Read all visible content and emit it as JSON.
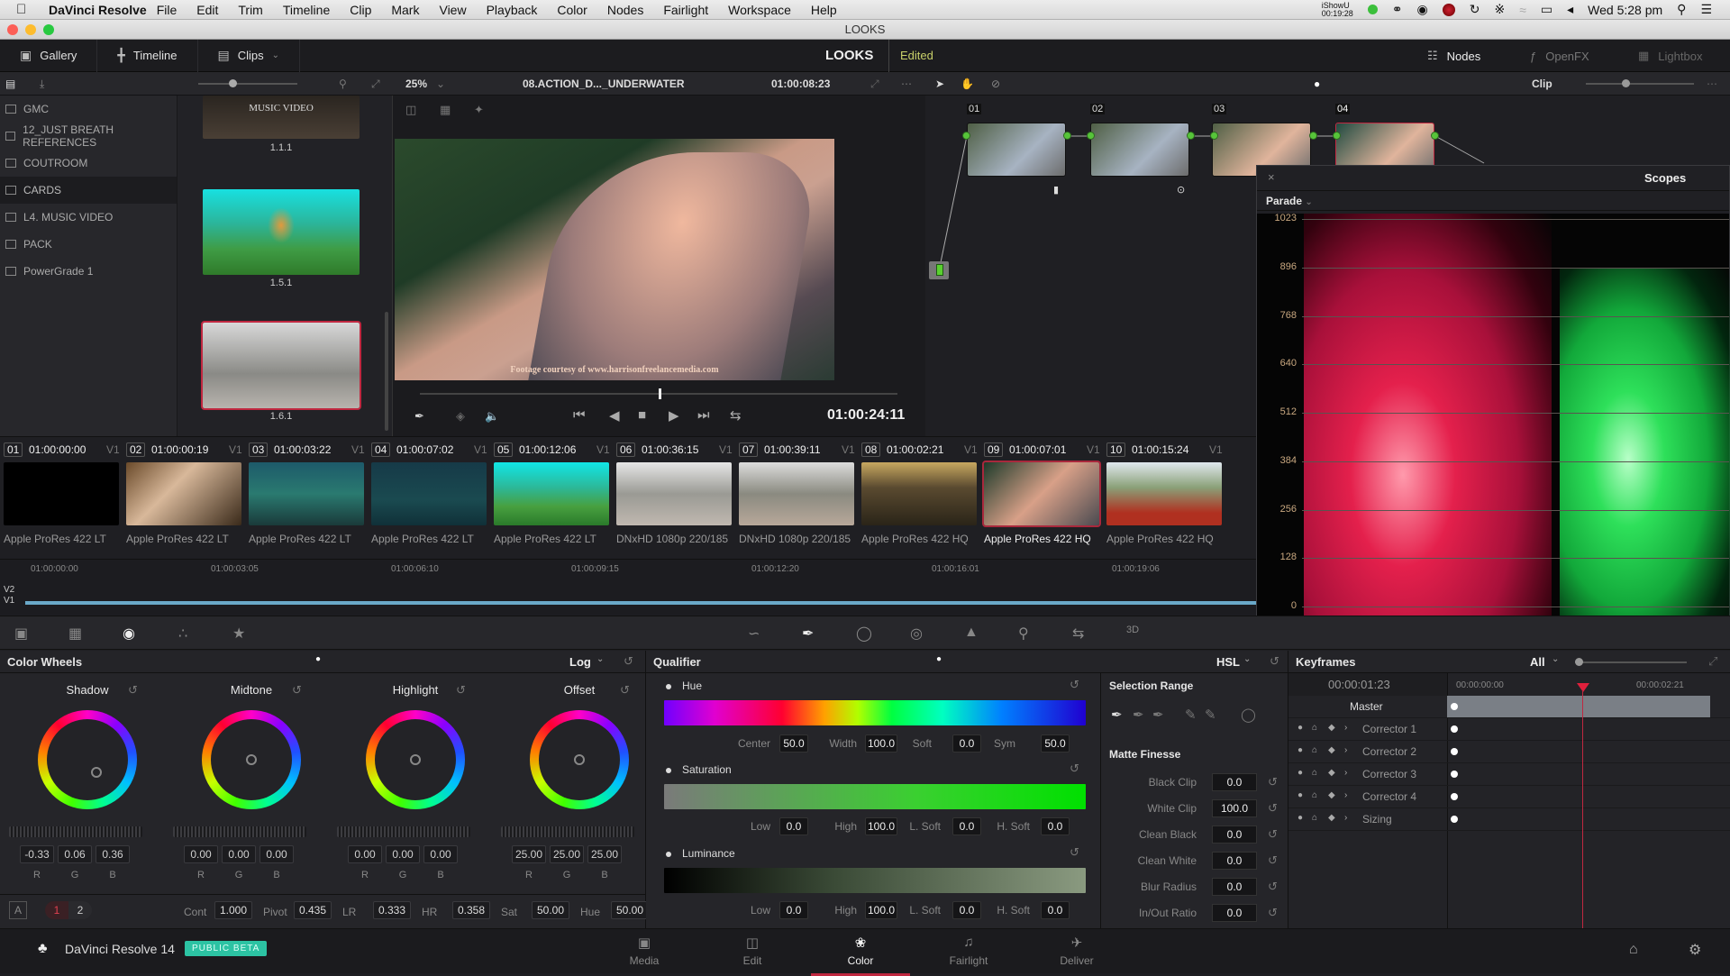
{
  "menubar": {
    "app_name": "DaVinci Resolve",
    "items": [
      "File",
      "Edit",
      "Trim",
      "Timeline",
      "Clip",
      "Mark",
      "View",
      "Playback",
      "Color",
      "Nodes",
      "Fairlight",
      "Workspace",
      "Help"
    ],
    "ishowu_label": "iShowU",
    "ishowu_time": "00:19:28",
    "clock": "Wed 5:28 pm"
  },
  "window": {
    "title": "LOOKS"
  },
  "toolbar": {
    "gallery": "Gallery",
    "timeline": "Timeline",
    "clips": "Clips",
    "project": "LOOKS",
    "status": "Edited",
    "nodes": "Nodes",
    "openfx": "OpenFX",
    "lightbox": "Lightbox"
  },
  "viewer_bar": {
    "zoom": "25%",
    "clip_name": "08.ACTION_D..._UNDERWATER",
    "timecode": "01:00:08:23",
    "node_mode": "Clip"
  },
  "gallery": {
    "albums": [
      {
        "label": "GMC",
        "selected": false
      },
      {
        "label": "12_JUST BREATH REFERENCES",
        "selected": false
      },
      {
        "label": "COUTROOM",
        "selected": false
      },
      {
        "label": "CARDS",
        "selected": true
      },
      {
        "label": "L4. MUSIC VIDEO",
        "selected": false
      },
      {
        "label": "PACK",
        "selected": false
      },
      {
        "label": "PowerGrade 1",
        "selected": false
      }
    ],
    "stills": [
      {
        "label": "1.1.1",
        "caption": "MUSIC VIDEO"
      },
      {
        "label": "1.5.1"
      },
      {
        "label": "1.6.1",
        "selected": true
      }
    ]
  },
  "viewer": {
    "caption": "Footage courtesy of www.harrisonfreelancemedia.com",
    "timecode": "01:00:24:11",
    "scrub_position": 0.5
  },
  "node_graph": {
    "nodes": [
      {
        "label": "01"
      },
      {
        "label": "02"
      },
      {
        "label": "03"
      },
      {
        "label": "04",
        "selected": true
      }
    ]
  },
  "scopes": {
    "title": "Scopes",
    "mode": "Parade",
    "scale": [
      "1023",
      "896",
      "768",
      "640",
      "512",
      "384",
      "256",
      "128",
      "0"
    ]
  },
  "clips": [
    {
      "num": "01",
      "tc": "01:00:00:00",
      "track": "V1",
      "codec": "Apple ProRes 422 LT",
      "thumb": "title"
    },
    {
      "num": "02",
      "tc": "01:00:00:19",
      "track": "V1",
      "codec": "Apple ProRes 422 LT",
      "thumb": "nudibranch"
    },
    {
      "num": "03",
      "tc": "01:00:03:22",
      "track": "V1",
      "codec": "Apple ProRes 422 LT",
      "thumb": "reef"
    },
    {
      "num": "04",
      "tc": "01:00:07:02",
      "track": "V1",
      "codec": "Apple ProRes 422 LT",
      "thumb": "diver"
    },
    {
      "num": "05",
      "tc": "01:00:12:06",
      "track": "V1",
      "codec": "Apple ProRes 422 LT",
      "thumb": "seadragon"
    },
    {
      "num": "06",
      "tc": "01:00:36:15",
      "track": "V1",
      "codec": "DNxHD 1080p 220/185",
      "thumb": "bush1"
    },
    {
      "num": "07",
      "tc": "01:00:39:11",
      "track": "V1",
      "codec": "DNxHD 1080p 220/185",
      "thumb": "bush2"
    },
    {
      "num": "08",
      "tc": "01:00:02:21",
      "track": "V1",
      "codec": "Apple ProRes 422 HQ",
      "thumb": "sunset"
    },
    {
      "num": "09",
      "tc": "01:00:07:01",
      "track": "V1",
      "codec": "Apple ProRes 422 HQ",
      "thumb": "river",
      "selected": true
    },
    {
      "num": "10",
      "tc": "01:00:15:24",
      "track": "V1",
      "codec": "Apple ProRes 422 HQ",
      "thumb": "outback"
    }
  ],
  "timeline_ruler": [
    "01:00:00:00",
    "01:00:03:05",
    "01:00:06:10",
    "01:00:09:15",
    "01:00:12:20",
    "01:00:16:01",
    "01:00:19:06"
  ],
  "tracks": [
    "V2",
    "V1"
  ],
  "color_wheels": {
    "title": "Color Wheels",
    "mode": "Log",
    "wheels": [
      {
        "name": "Shadow",
        "r": "-0.33",
        "g": "0.06",
        "b": "0.36"
      },
      {
        "name": "Midtone",
        "r": "0.00",
        "g": "0.00",
        "b": "0.00"
      },
      {
        "name": "Highlight",
        "r": "0.00",
        "g": "0.00",
        "b": "0.00"
      },
      {
        "name": "Offset",
        "r": "25.00",
        "g": "25.00",
        "b": "25.00"
      }
    ],
    "channel_labels": [
      "R",
      "G",
      "B"
    ],
    "mode_a": "A",
    "page1": "1",
    "page2": "2",
    "params": [
      {
        "label": "Cont",
        "value": "1.000"
      },
      {
        "label": "Pivot",
        "value": "0.435"
      },
      {
        "label": "LR",
        "value": "0.333"
      },
      {
        "label": "HR",
        "value": "0.358"
      },
      {
        "label": "Sat",
        "value": "50.00"
      },
      {
        "label": "Hue",
        "value": "50.00"
      }
    ]
  },
  "qualifier": {
    "title": "Qualifier",
    "mode": "HSL",
    "hue": {
      "label": "Hue",
      "center_label": "Center",
      "center": "50.0",
      "width_label": "Width",
      "width": "100.0",
      "soft_label": "Soft",
      "soft": "0.0",
      "sym_label": "Sym",
      "sym": "50.0"
    },
    "saturation": {
      "label": "Saturation",
      "low_label": "Low",
      "low": "0.0",
      "high_label": "High",
      "high": "100.0",
      "lsoft_label": "L. Soft",
      "lsoft": "0.0",
      "hsoft_label": "H. Soft",
      "hsoft": "0.0"
    },
    "luminance": {
      "label": "Luminance",
      "low_label": "Low",
      "low": "0.0",
      "high_label": "High",
      "high": "100.0",
      "lsoft_label": "L. Soft",
      "lsoft": "0.0",
      "hsoft_label": "H. Soft",
      "hsoft": "0.0"
    },
    "selection_range": "Selection Range",
    "matte_finesse": "Matte Finesse",
    "matte": [
      {
        "label": "Black Clip",
        "value": "0.0"
      },
      {
        "label": "White Clip",
        "value": "100.0"
      },
      {
        "label": "Clean Black",
        "value": "0.0"
      },
      {
        "label": "Clean White",
        "value": "0.0"
      },
      {
        "label": "Blur Radius",
        "value": "0.0"
      },
      {
        "label": "In/Out Ratio",
        "value": "0.0"
      }
    ]
  },
  "keyframes": {
    "title": "Keyframes",
    "filter": "All",
    "current_tc": "00:00:01:23",
    "ruler_start": "00:00:00:00",
    "ruler_end": "00:00:02:21",
    "rows": [
      "Master",
      "Corrector 1",
      "Corrector 2",
      "Corrector 3",
      "Corrector 4",
      "Sizing"
    ]
  },
  "pagebar": {
    "app_label": "DaVinci Resolve 14",
    "badge": "PUBLIC BETA",
    "pages": [
      {
        "label": "Media"
      },
      {
        "label": "Edit"
      },
      {
        "label": "Color",
        "active": true
      },
      {
        "label": "Fairlight"
      },
      {
        "label": "Deliver"
      }
    ]
  }
}
